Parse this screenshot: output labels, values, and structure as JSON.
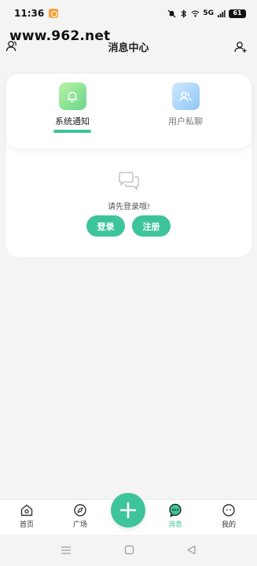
{
  "status_bar": {
    "time": "11:36",
    "network": "5G",
    "battery": "61"
  },
  "watermark": "www.962.net",
  "header": {
    "title": "消息中心",
    "left_icon": "contacts-icon",
    "right_icon": "add-friend-icon"
  },
  "tabs": [
    {
      "label": "系统通知",
      "icon": "bell-icon",
      "active": true
    },
    {
      "label": "用户私聊",
      "icon": "users-icon",
      "active": false
    }
  ],
  "empty_state": {
    "icon": "chat-bubbles-icon",
    "text": "请先登录哦!"
  },
  "buttons": {
    "login": "登录",
    "register": "注册"
  },
  "bottom_nav": [
    {
      "label": "首页",
      "icon": "home-icon",
      "active": false
    },
    {
      "label": "广场",
      "icon": "compass-icon",
      "active": false
    },
    {
      "label": "",
      "icon": "plus-icon",
      "active": false
    },
    {
      "label": "消息",
      "icon": "message-icon",
      "active": true
    },
    {
      "label": "我的",
      "icon": "profile-icon",
      "active": false
    }
  ],
  "colors": {
    "accent": "#3ec49b",
    "background": "#f4f4f4"
  }
}
